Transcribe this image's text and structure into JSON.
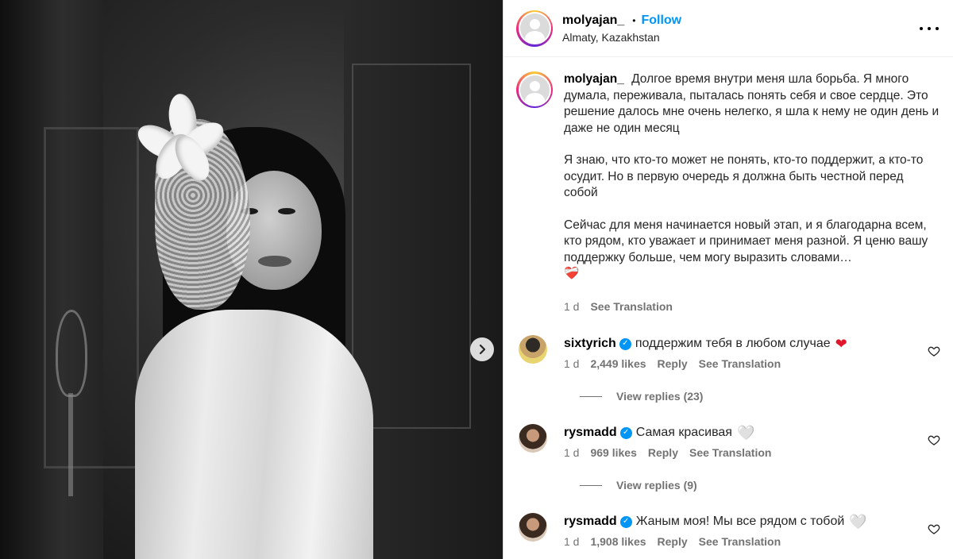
{
  "post": {
    "username": "molyajan_",
    "follow_label": "Follow",
    "separator": "•",
    "location": "Almaty, Kazakhstan",
    "more_label": "More options"
  },
  "caption": {
    "username": "molyajan_",
    "paragraphs": [
      "Долгое время внутри меня шла борьба. Я много думала, переживала, пыталась понять себя и свое сердце. Это решение далось мне очень нелегко, я шла к нему не один день и даже не один месяц",
      "Я знаю, что кто-то может не понять, кто-то поддержит, а кто-то осудит. Но в первую очередь я должна быть честной перед собой",
      "Сейчас для меня начинается новый этап, и я благодарна всем, кто рядом, кто уважает и принимает меня разной. Я ценю вашу поддержку больше, чем могу выразить словами…"
    ],
    "emoji": "❤️‍🩹",
    "time": "1 d",
    "see_translation": "See Translation"
  },
  "comments": [
    {
      "username": "sixtyrich",
      "text": "поддержим тебя в любом случае",
      "emoji": "❤",
      "emoji_style": "red",
      "time": "1 d",
      "likes": "2,449 likes",
      "reply": "Reply",
      "see_translation": "See Translation",
      "view_replies": "View replies (23)"
    },
    {
      "username": "rysmadd",
      "text": "Самая красивая",
      "emoji": "🤍",
      "emoji_style": "white",
      "time": "1 d",
      "likes": "969 likes",
      "reply": "Reply",
      "see_translation": "See Translation",
      "view_replies": "View replies (9)"
    },
    {
      "username": "rysmadd",
      "text": "Жаным моя! Мы все рядом с тобой",
      "emoji": "🤍",
      "emoji_style": "white",
      "time": "1 d",
      "likes": "1,908 likes",
      "reply": "Reply",
      "see_translation": "See Translation"
    }
  ],
  "icons": {
    "next": "chevron-right-icon",
    "like": "heart-outline-icon",
    "verified": "verified-badge-icon",
    "more": "more-horizontal-icon"
  },
  "colors": {
    "link_blue": "#0095f6",
    "secondary_text": "#737373",
    "heart_red": "#e0162b"
  }
}
